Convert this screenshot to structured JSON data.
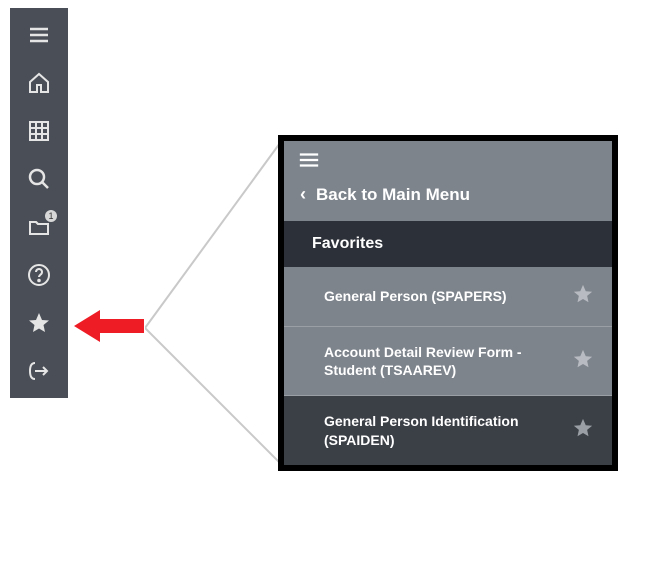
{
  "sidebar": {
    "items": [
      {
        "name": "menu",
        "icon": "hamburger-icon"
      },
      {
        "name": "home",
        "icon": "home-icon"
      },
      {
        "name": "apps",
        "icon": "grid-icon"
      },
      {
        "name": "search",
        "icon": "search-icon"
      },
      {
        "name": "folder",
        "icon": "folder-icon",
        "badge": "1"
      },
      {
        "name": "help",
        "icon": "help-icon"
      },
      {
        "name": "favorites",
        "icon": "star-icon"
      },
      {
        "name": "signout",
        "icon": "signout-icon"
      }
    ]
  },
  "panel": {
    "back_label": "Back to Main Menu",
    "header": "Favorites",
    "items": [
      {
        "label": "General Person (SPAPERS)",
        "dark": false
      },
      {
        "label": "Account Detail Review Form - Student (TSAAREV)",
        "dark": false
      },
      {
        "label": "General Person Identification (SPAIDEN)",
        "dark": true
      }
    ]
  }
}
